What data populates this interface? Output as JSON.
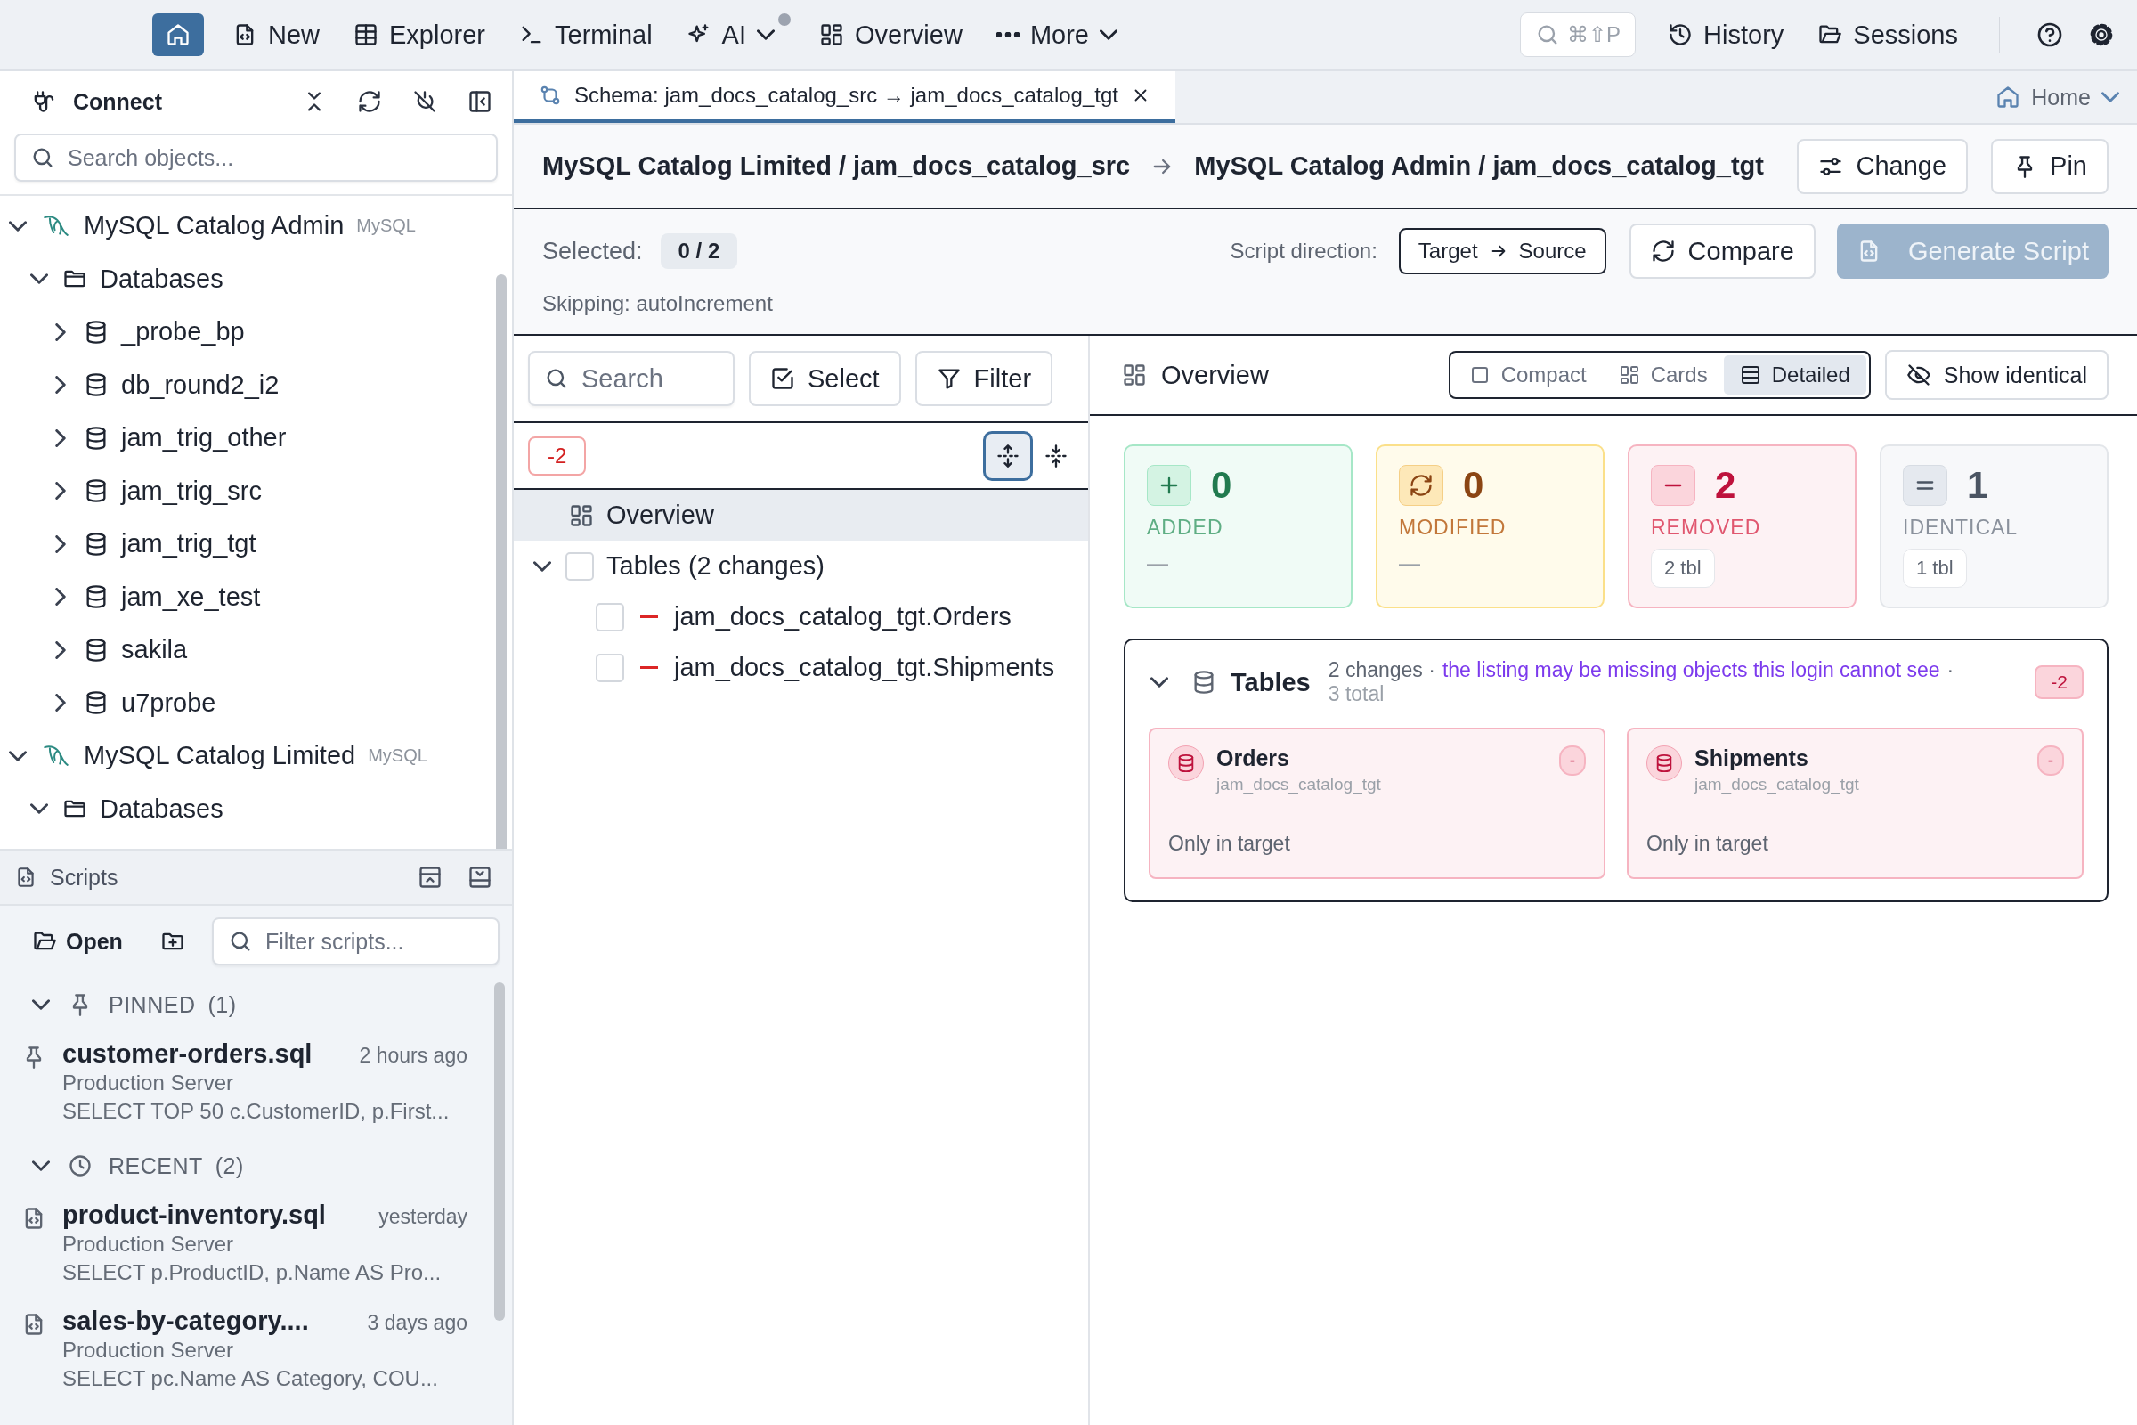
{
  "topbar": {
    "home": {
      "selected": true
    },
    "nav": [
      {
        "label": "New",
        "selected": false,
        "dropdown": false,
        "dot": false
      },
      {
        "label": "Explorer",
        "selected": false,
        "dropdown": false,
        "dot": false
      },
      {
        "label": "Terminal",
        "selected": false,
        "dropdown": false,
        "dot": false
      },
      {
        "label": "AI",
        "selected": false,
        "dropdown": true,
        "dot": true
      },
      {
        "label": "Overview",
        "selected": false,
        "dropdown": false,
        "dot": false
      },
      {
        "label": "More",
        "selected": false,
        "dropdown": true,
        "dot": false
      }
    ],
    "shortcut": "⌘⇧P",
    "right": [
      "History",
      "Sessions"
    ]
  },
  "sidebar": {
    "title": "Connect",
    "search_placeholder": "Search objects...",
    "tree": [
      {
        "label": "MySQL Catalog Admin",
        "tag": "MySQL",
        "kind": "connection",
        "expanded": true,
        "children": [
          {
            "label": "Databases",
            "kind": "folder",
            "expanded": true,
            "children": [
              {
                "label": "_probe_bp",
                "kind": "database",
                "expanded": false
              },
              {
                "label": "db_round2_i2",
                "kind": "database",
                "expanded": false
              },
              {
                "label": "jam_trig_other",
                "kind": "database",
                "expanded": false
              },
              {
                "label": "jam_trig_src",
                "kind": "database",
                "expanded": false
              },
              {
                "label": "jam_trig_tgt",
                "kind": "database",
                "expanded": false
              },
              {
                "label": "jam_xe_test",
                "kind": "database",
                "expanded": false
              },
              {
                "label": "sakila",
                "kind": "database",
                "expanded": false
              },
              {
                "label": "u7probe",
                "kind": "database",
                "expanded": false
              }
            ]
          }
        ]
      },
      {
        "label": "MySQL Catalog Limited",
        "tag": "MySQL",
        "kind": "connection",
        "expanded": true,
        "children": [
          {
            "label": "Databases",
            "kind": "folder",
            "expanded": true
          }
        ]
      }
    ]
  },
  "scripts": {
    "title": "Scripts",
    "open": "Open",
    "filter_placeholder": "Filter scripts...",
    "groups": [
      {
        "label": "PINNED",
        "count": "(1)",
        "kind": "pinned",
        "expanded": true,
        "items": [
          {
            "name": "customer-orders.sql",
            "time": "2 hours ago",
            "server": "Production Server",
            "preview": "SELECT TOP 50 c.CustomerID, p.First..."
          }
        ]
      },
      {
        "label": "RECENT",
        "count": "(2)",
        "kind": "recent",
        "expanded": true,
        "items": [
          {
            "name": "product-inventory.sql",
            "time": "yesterday",
            "server": "Production Server",
            "preview": "SELECT p.ProductID, p.Name AS Pro..."
          },
          {
            "name": "sales-by-category....",
            "time": "3 days ago",
            "server": "Production Server",
            "preview": "SELECT pc.Name AS Category, COU..."
          }
        ]
      }
    ]
  },
  "tabs": [
    {
      "title": "Schema: jam_docs_catalog_src → jam_docs_catalog_tgt",
      "selected": true
    }
  ],
  "home_tab": "Home",
  "header": {
    "source": "MySQL Catalog Limited / jam_docs_catalog_src",
    "target": "MySQL Catalog Admin / jam_docs_catalog_tgt",
    "buttons": [
      "Change",
      "Pin"
    ]
  },
  "toolbar": {
    "selected_label": "Selected:",
    "selected_value": "0 / 2",
    "skipping": "Skipping: autoIncrement",
    "direction_label": "Script direction:",
    "direction_from": "Target",
    "direction_to": "Source",
    "compare": "Compare",
    "generate": {
      "label": "Generate Script",
      "disabled": true
    }
  },
  "changes": {
    "search_placeholder": "Search",
    "select": "Select",
    "filter": "Filter",
    "badge": "-2",
    "tree": [
      {
        "label": "Overview",
        "kind": "overview",
        "selected": true
      },
      {
        "label": "Tables (2 changes)",
        "kind": "group",
        "selected": false,
        "expanded": true,
        "checked": false,
        "children": [
          {
            "label": "jam_docs_catalog_tgt.Orders",
            "kind": "removed",
            "checked": false
          },
          {
            "label": "jam_docs_catalog_tgt.Shipments",
            "kind": "removed",
            "checked": false
          }
        ]
      }
    ]
  },
  "overview": {
    "title": "Overview",
    "views": [
      {
        "label": "Compact",
        "selected": false
      },
      {
        "label": "Cards",
        "selected": false
      },
      {
        "label": "Detailed",
        "selected": true
      }
    ],
    "show_identical": "Show identical",
    "stats": [
      {
        "kind": "added",
        "count": "0",
        "label": "ADDED",
        "detail": "—"
      },
      {
        "kind": "modified",
        "count": "0",
        "label": "MODIFIED",
        "detail": "—"
      },
      {
        "kind": "removed",
        "count": "2",
        "label": "REMOVED",
        "chip": "2 tbl"
      },
      {
        "kind": "identical",
        "count": "1",
        "label": "IDENTICAL",
        "chip": "1 tbl"
      }
    ],
    "section": {
      "title": "Tables",
      "expanded": true,
      "summary": "2 changes ·",
      "warning": "the listing may be missing objects this login cannot see",
      "separator": "·",
      "total": "3 total",
      "badge": "-2",
      "items": [
        {
          "name": "Orders",
          "schema": "jam_docs_catalog_tgt",
          "badge": "-",
          "note": "Only in target",
          "kind": "removed"
        },
        {
          "name": "Shipments",
          "schema": "jam_docs_catalog_tgt",
          "badge": "-",
          "note": "Only in target",
          "kind": "removed"
        }
      ]
    }
  }
}
